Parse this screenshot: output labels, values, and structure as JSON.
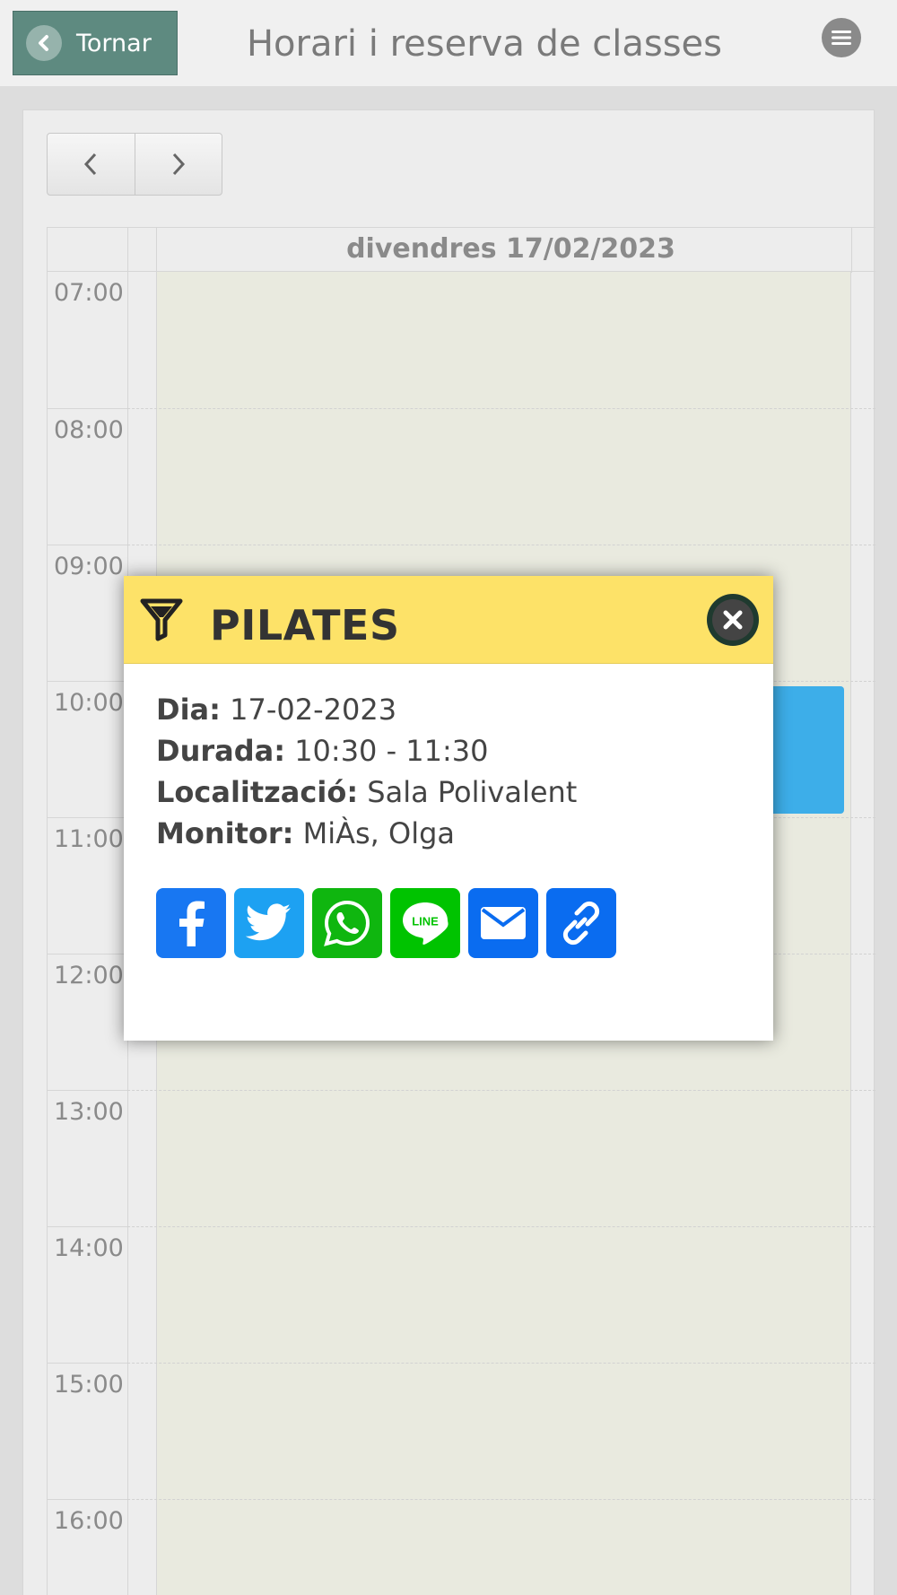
{
  "header": {
    "back_label": "Tornar",
    "title": "Horari i reserva de classes"
  },
  "calendar": {
    "day_label": "divendres 17/02/2023",
    "hours": [
      "07:00",
      "08:00",
      "09:00",
      "10:00",
      "11:00",
      "12:00",
      "13:00",
      "14:00",
      "15:00",
      "16:00"
    ],
    "event_color": "#3daee9",
    "day_bg": "#e9eadf"
  },
  "modal": {
    "title": "PILATES",
    "header_color": "#fde268",
    "fields": {
      "dia_label": "Dia:",
      "dia_value": "17-02-2023",
      "durada_label": "Durada:",
      "durada_value": "10:30 - 11:30",
      "loc_label": "Localització:",
      "loc_value": "Sala Polivalent",
      "monitor_label": "Monitor:",
      "monitor_value": "MiÀs, Olga"
    },
    "share": [
      {
        "icon": "facebook-icon",
        "color": "#1877f2"
      },
      {
        "icon": "twitter-icon",
        "color": "#1da1f2"
      },
      {
        "icon": "whatsapp-icon",
        "color": "#0fb60f"
      },
      {
        "icon": "line-icon",
        "color": "#00c300"
      },
      {
        "icon": "email-icon",
        "color": "#0a6cf0"
      },
      {
        "icon": "link-icon",
        "color": "#0a6cf0"
      }
    ]
  }
}
